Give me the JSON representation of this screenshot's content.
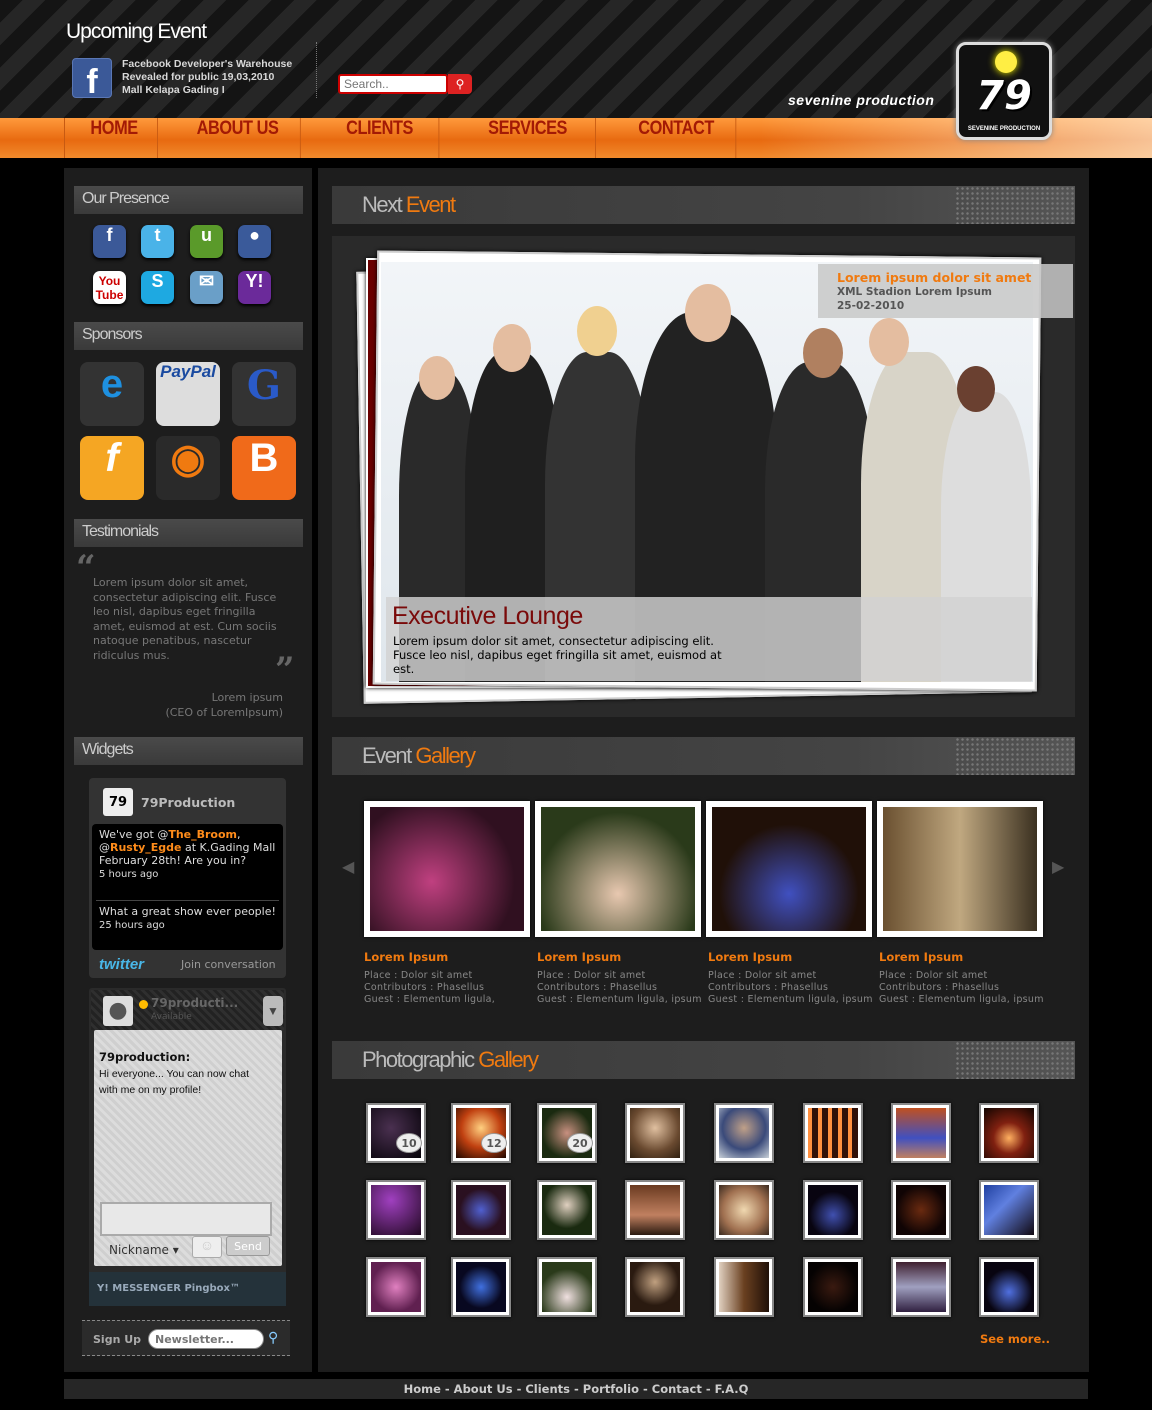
{
  "header": {
    "upcoming_title": "Upcoming Event",
    "event_line1": "Facebook Developer's Warehouse",
    "event_line2": "Revealed for public 19,03,2010",
    "event_line3": "Mall Kelapa Gading I",
    "search_placeholder": "Search..",
    "brand": "sevenine production",
    "logo_text": "79",
    "logo_caption": "SEVENINE PRODUCTION"
  },
  "nav": [
    "HOME",
    "ABOUT US",
    "CLIENTS",
    "SERVICES",
    "CONTACT"
  ],
  "sidebar": {
    "presence_title": "Our Presence",
    "social_icons": [
      "facebook-icon",
      "twitter-icon",
      "ustream-icon",
      "myspace-icon",
      "youtube-icon",
      "skype-icon",
      "chat-bubble-icon",
      "yahoo-icon"
    ],
    "sponsors_title": "Sponsors",
    "sponsors": [
      "internet-explorer-icon",
      "paypal-icon",
      "google-icon",
      "flash-icon",
      "firefox-icon",
      "blogger-icon"
    ],
    "paypal_label": "PayPal",
    "testimonials_title": "Testimonials",
    "testimonial_text": "Lorem ipsum dolor sit amet, consectetur adipiscing elit. Fusce leo nisl, dapibus eget fringilla amet, euismod at est. Cum sociis natoque penatibus, nascetur ridiculus mus.",
    "testimonial_author": "Lorem ipsum",
    "testimonial_role": "(CEO of LoremIpsum)",
    "widgets_title": "Widgets",
    "twitter": {
      "name": "79Production",
      "tweet1_a": "We've got @",
      "tweet1_user1": "The_Broom",
      "tweet1_b": ", @",
      "tweet1_user2": "Rusty_Egde",
      "tweet1_c": " at K.Gading Mall February 28th! Are you in?",
      "tweet1_time": "5 hours ago",
      "tweet2": "What a great show ever people!",
      "tweet2_time": "25 hours ago",
      "logo": "twitter",
      "join": "Join conversation"
    },
    "pingbox": {
      "name": "79producti...",
      "status": "Available",
      "sender": "79production:",
      "message": "Hi everyone... You can now chat with me on my profile!",
      "nickname": "Nickname",
      "send": "Send",
      "footer": "MESSENGER Pingbox™"
    },
    "signup_label": "Sign Up",
    "newsletter_placeholder": "Newsletter..."
  },
  "main": {
    "next_event_a": "Next ",
    "next_event_b": "Event",
    "event_info_title": "Lorem ipsum dolor sit amet",
    "event_info_place": "XML Stadion Lorem Ipsum",
    "event_info_date": "25-02-2010",
    "caption_title": "Executive Lounge",
    "caption_desc": "Lorem ipsum dolor sit amet, consectetur adipiscing elit. Fusce leo nisl, dapibus eget fringilla sit amet, euismod at est.",
    "event_gallery_a": "Event ",
    "event_gallery_b": "Gallery",
    "gallery": [
      {
        "title": "Lorem Ipsum",
        "place": "Place : Dolor sit amet",
        "contributors": "Contributors : Phasellus",
        "guest": "Guest : Elementum ligula,"
      },
      {
        "title": "Lorem Ipsum",
        "place": "Place : Dolor sit amet",
        "contributors": "Contributors : Phasellus",
        "guest": "Guest : Elementum ligula, ipsum"
      },
      {
        "title": "Lorem Ipsum",
        "place": "Place : Dolor sit amet",
        "contributors": "Contributors : Phasellus",
        "guest": "Guest : Elementum ligula, ipsum"
      },
      {
        "title": "Lorem Ipsum",
        "place": "Place : Dolor sit amet",
        "contributors": "Contributors : Phasellus",
        "guest": "Guest : Elementum ligula, ipsum"
      }
    ],
    "photo_gallery_a": "Photographic ",
    "photo_gallery_b": "Gallery",
    "photo_counts": [
      "10",
      "12",
      "20"
    ],
    "see_more": "See more.."
  },
  "footer": "Home - About Us - Clients - Portfolio - Contact - F.A.Q"
}
